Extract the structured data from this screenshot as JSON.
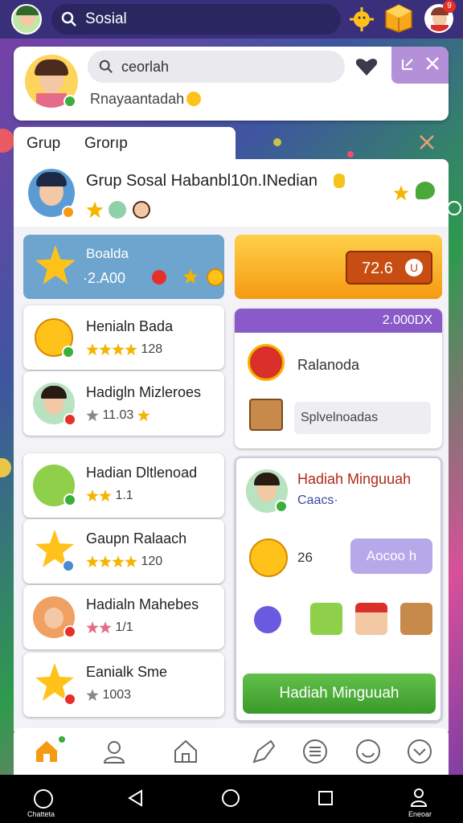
{
  "search": {
    "value": "Sosial"
  },
  "notif_count": "9",
  "profile": {
    "search_value": "ceorlah",
    "name": "Rnayaantadah"
  },
  "tabs": [
    "Grup",
    "Grorıp"
  ],
  "group": {
    "title": "Grup Sosal Habanbl10n.INedian"
  },
  "balance": {
    "title": "Boalda",
    "value": "·2.A00",
    "amount": "72.6"
  },
  "left_rows": [
    {
      "title": "Henialn Bada",
      "sub": "128"
    },
    {
      "title": "Hadigln Mizleroes",
      "sub": "11.03"
    },
    {
      "title": "Hadian Dltlenoad",
      "sub": "1.1"
    },
    {
      "title": "Gaupn Ralaach",
      "sub": "120"
    },
    {
      "title": "Hadialn Mahebes",
      "sub": "1/1"
    },
    {
      "title": "Eanialk Sme",
      "sub": "1003"
    }
  ],
  "right_panel": {
    "header_value": "2.000DX",
    "item1": "Ralanoda",
    "item2_placeholder": "Splvelnoadas"
  },
  "reward": {
    "title": "Hadiah Minguuah",
    "subtitle": "Caacs·",
    "count": "26",
    "action_label": "Aocoo h",
    "button_label": "Hadiah Minguuah"
  },
  "sysbar": {
    "left_label": "Chatteta",
    "right_label": "Eneoar"
  },
  "colors": {
    "accent_orange": "#f59a12",
    "accent_purple": "#8a5bc8",
    "accent_green": "#4aa838",
    "topbar": "#3a2f7a"
  }
}
